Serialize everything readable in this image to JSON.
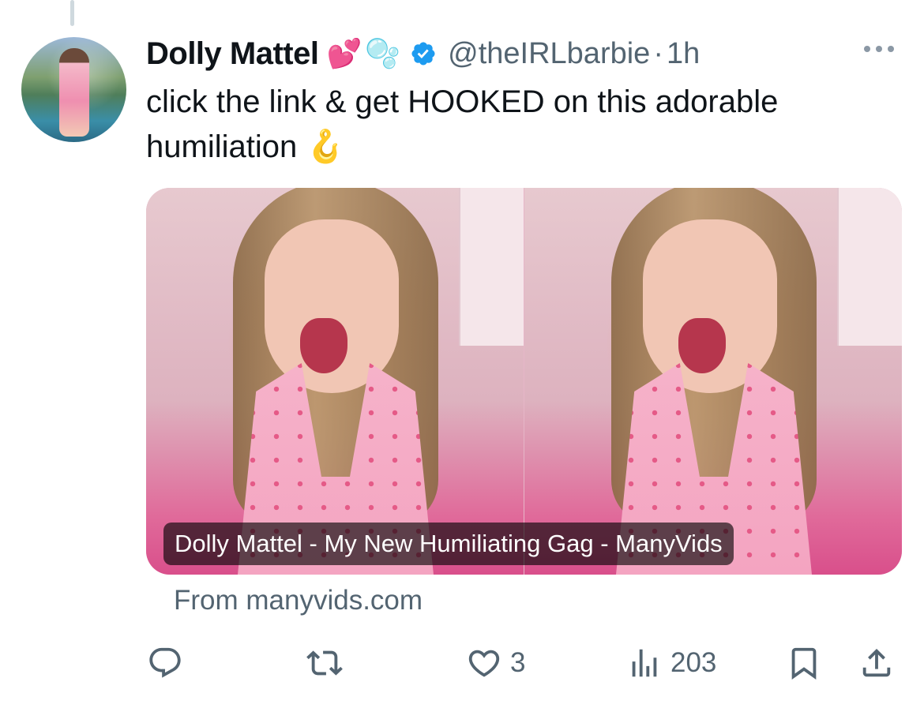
{
  "tweet": {
    "display_name": "Dolly Mattel",
    "emoji_heart": "💕",
    "emoji_bubbles": "🫧",
    "handle": "@theIRLbarbie",
    "separator": "·",
    "time": "1h",
    "text": "click the link & get HOOKED on this adorable humiliation",
    "text_emoji": "🪝"
  },
  "card": {
    "title": "Dolly Mattel - My New Humiliating Gag - ManyVids",
    "domain": "From manyvids.com"
  },
  "actions": {
    "reply_icon": "reply-icon",
    "retweet_icon": "retweet-icon",
    "like_icon": "like-icon",
    "like_count": "3",
    "views_icon": "views-icon",
    "views_count": "203",
    "bookmark_icon": "bookmark-icon",
    "share_icon": "share-icon"
  },
  "colors": {
    "text": "#0f1419",
    "secondary": "#536471",
    "verified": "#1d9bf0"
  }
}
